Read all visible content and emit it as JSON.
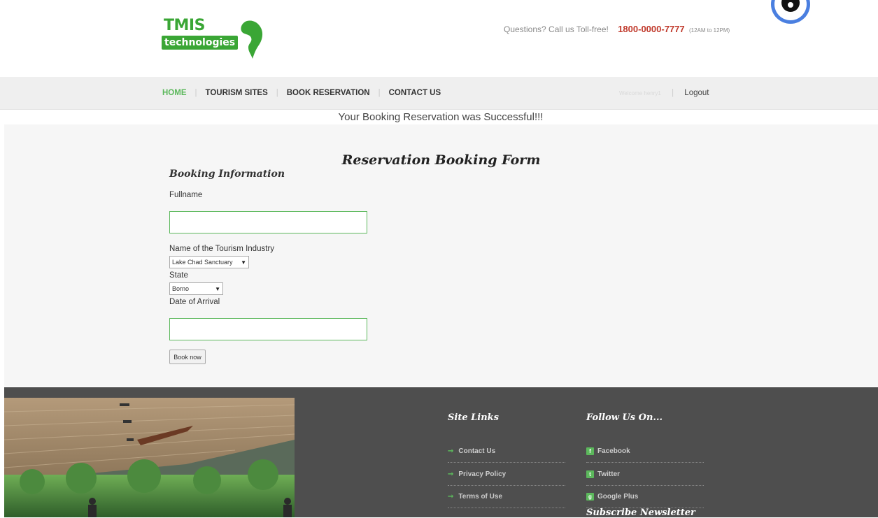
{
  "header": {
    "logo_line1": "TMIS",
    "logo_line2": "technologies",
    "contact_prefix": "Questions? Call us Toll-free!",
    "phone": "1800-0000-7777",
    "hours": "(12AM to 12PM)"
  },
  "nav": {
    "items": [
      {
        "label": "HOME"
      },
      {
        "label": "TOURISM SITES"
      },
      {
        "label": "BOOK RESERVATION"
      },
      {
        "label": "CONTACT US"
      }
    ],
    "welcome": "Welcome henry1",
    "logout": "Logout"
  },
  "message": "Your Booking Reservation was Successful!!!",
  "form": {
    "title": "Reservation Booking Form",
    "section": "Booking Information",
    "fullname_label": "Fullname",
    "fullname_value": "",
    "industry_label": "Name of the Tourism Industry",
    "industry_selected": "Lake Chad Sanctuary",
    "state_label": "State",
    "state_selected": "Borno",
    "arrival_label": "Date of Arrival",
    "arrival_value": "",
    "submit_label": "Book now"
  },
  "footer": {
    "site_links_title": "Site Links",
    "site_links": [
      {
        "label": "Contact Us"
      },
      {
        "label": "Privacy Policy"
      },
      {
        "label": "Terms of Use"
      }
    ],
    "follow_title": "Follow Us On...",
    "social": [
      {
        "label": "Facebook",
        "icon": "facebook-icon"
      },
      {
        "label": "Twitter",
        "icon": "twitter-icon"
      },
      {
        "label": "Google Plus",
        "icon": "google-plus-icon"
      }
    ],
    "newsletter_title": "Subscribe Newsletter"
  },
  "colors": {
    "accent_green": "#5cb85c",
    "phone_red": "#c0392b",
    "footer_bg": "#4e4e4e"
  }
}
